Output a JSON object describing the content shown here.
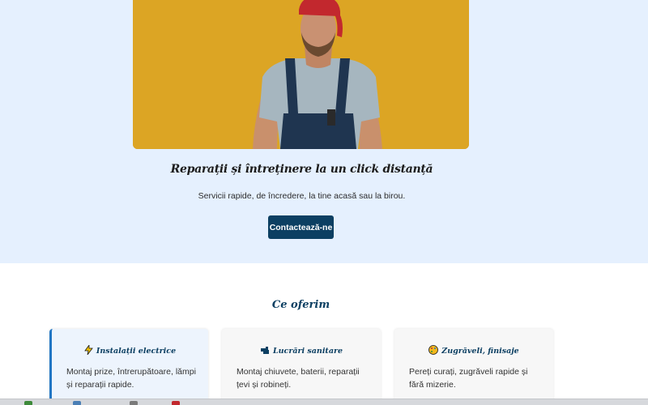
{
  "hero": {
    "image_alt": "Meseriaș cu șapcă roșie și salopetă",
    "title": "Reparații și întreținere la un click distanță",
    "subtitle": "Servicii rapide, de încredere, la tine acasă sau la birou.",
    "cta_label": "Contactează-ne"
  },
  "services": {
    "title": "Ce oferim",
    "cards": [
      {
        "icon": "lightning-icon",
        "title": "Instalații electrice",
        "text": "Montaj prize, întrerupătoare, lămpi și reparații rapide."
      },
      {
        "icon": "plumbing-icon",
        "title": "Lucrări sanitare",
        "text": "Montaj chiuvete, baterii, reparații țevi și robineți."
      },
      {
        "icon": "paint-palette-icon",
        "title": "Zugrăveli, finisaje",
        "text": "Pereți curați, zugrăveli rapide și fără mizerie."
      }
    ]
  },
  "colors": {
    "hero_bg": "#e5f0fe",
    "accent": "#0c3f62",
    "card_highlight": "#2176c4",
    "image_bg": "#d9a220"
  }
}
